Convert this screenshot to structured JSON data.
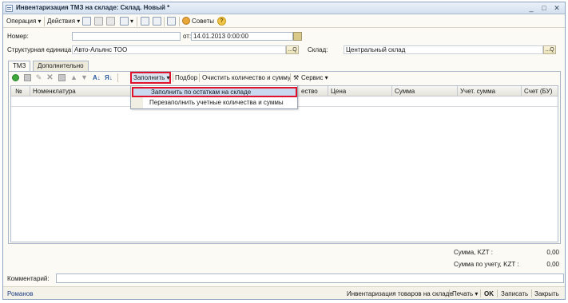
{
  "window": {
    "title": "Инвентаризация ТМЗ на складе: Склад. Новый *",
    "minimize_glyph": "_",
    "maximize_glyph": "□",
    "close_glyph": "✕"
  },
  "toolbar": {
    "operation": "Операция ▾",
    "actions": "Действия ▾",
    "tips": "Советы",
    "help_glyph": "?"
  },
  "form": {
    "number_label": "Номер:",
    "number_value": "",
    "date_label": "от:",
    "date_value": "14.01.2013  0:00:00",
    "unit_label": "Структурная единица:",
    "unit_value": "Авто-Альянс ТОО",
    "warehouse_label": "Склад:",
    "warehouse_value": "Центральный склад",
    "select_glyph": "...Q"
  },
  "tabs": [
    {
      "label": "ТМЗ"
    },
    {
      "label": "Дополнительно"
    }
  ],
  "panel_toolbar": {
    "fill_button": "Заполнить ▾",
    "selection": "Подбор",
    "clear": "Очистить количество и сумму",
    "service": "Сервис ▾"
  },
  "grid": {
    "columns": [
      "№",
      "Номенклатура",
      "ество",
      "Цена",
      "Сумма",
      "Учет. сумма",
      "Счет (БУ)"
    ]
  },
  "fill_menu": {
    "items": [
      "Заполнить по остаткам на складе",
      "Перезаполнить учетные количества и суммы"
    ]
  },
  "totals": {
    "sum_label": "Сумма, KZT :",
    "sum_value": "0,00",
    "acc_sum_label": "Сумма по учету, KZT :",
    "acc_sum_value": "0,00"
  },
  "comment": {
    "label": "Комментарий:",
    "value": ""
  },
  "statusbar": {
    "author": "Романов",
    "report": "Инвентаризация товаров на складе",
    "print": "Печать ▾",
    "ok": "OK",
    "save": "Записать",
    "close": "Закрыть"
  },
  "colors": {
    "highlight_border": "#e0112a",
    "menu_highlight": "#c9d9f0",
    "window_bg": "#fbfaf4"
  }
}
